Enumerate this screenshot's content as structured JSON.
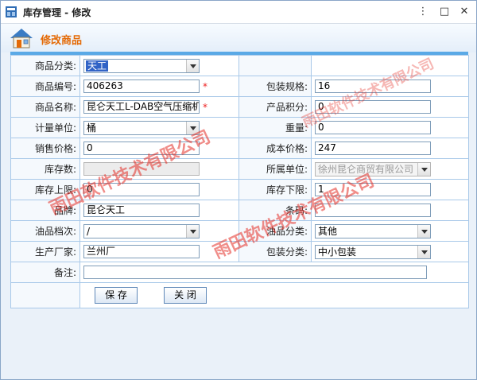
{
  "window": {
    "title": "库存管理 - 修改",
    "controls": {
      "menu": "⋮",
      "minimize": "□",
      "close": "✕"
    }
  },
  "header": {
    "title": "修改商品"
  },
  "form": {
    "category": {
      "label": "商品分类:",
      "value": "天工"
    },
    "code": {
      "label": "商品编号:",
      "value": "406263",
      "required": "*"
    },
    "pack_spec": {
      "label": "包装规格:",
      "value": "16"
    },
    "name": {
      "label": "商品名称:",
      "value": "昆仑天工L-DAB空气压缩机油",
      "required": "*"
    },
    "points": {
      "label": "产品积分:",
      "value": "0"
    },
    "unit": {
      "label": "计量单位:",
      "value": "桶"
    },
    "weight": {
      "label": "重量:",
      "value": "0"
    },
    "sale_price": {
      "label": "销售价格:",
      "value": "0"
    },
    "cost_price": {
      "label": "成本价格:",
      "value": "247"
    },
    "stock_qty": {
      "label": "库存数:",
      "value": ""
    },
    "owner_unit": {
      "label": "所属单位:",
      "value": "徐州昆仑商贸有限公司"
    },
    "stock_max": {
      "label": "库存上限:",
      "value": "0"
    },
    "stock_min": {
      "label": "库存下限:",
      "value": "1"
    },
    "brand": {
      "label": "品牌:",
      "value": "昆仑天工"
    },
    "barcode": {
      "label": "条码:",
      "value": ""
    },
    "oil_grade": {
      "label": "油品档次:",
      "value": "/"
    },
    "oil_category": {
      "label": "油品分类:",
      "value": "其他"
    },
    "manufacturer": {
      "label": "生产厂家:",
      "value": "兰州厂"
    },
    "pack_category": {
      "label": "包装分类:",
      "value": "中小包装"
    },
    "remark": {
      "label": "备注:",
      "value": ""
    }
  },
  "buttons": {
    "save": "保 存",
    "close": "关 闭"
  },
  "watermarks": {
    "text1": "雨田软件技术有限公司",
    "text2": "雨田软件技术有限公司",
    "text3": "雨田软件技术有限公司"
  },
  "colors": {
    "accent": "#e46a06",
    "title_bar_line": "#5aa9e6",
    "watermark": "#e43028"
  }
}
